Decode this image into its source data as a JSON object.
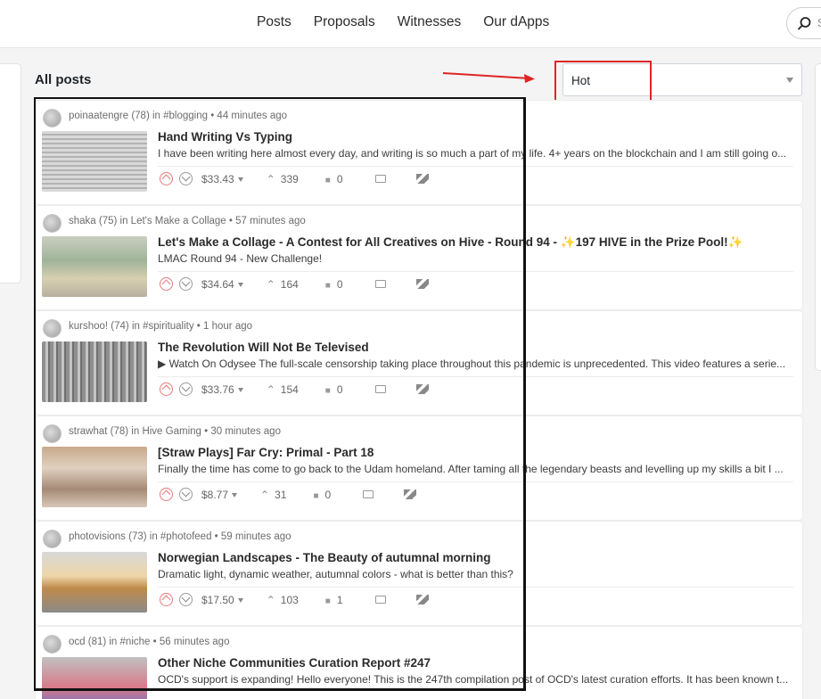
{
  "nav": {
    "items": [
      "Posts",
      "Proposals",
      "Witnesses",
      "Our dApps"
    ],
    "search_peek": "S"
  },
  "section_title": "All posts",
  "sort": {
    "selected": "Hot"
  },
  "colors": {
    "highlight": "#e02525",
    "frame": "#111111"
  },
  "posts": [
    {
      "meta": "poinaatengre (78) in #blogging • 44 minutes ago",
      "title": "Hand Writing Vs Typing",
      "excerpt": "I have been writing here almost every day, and writing is so much a part of my life. 4+ years on the blockchain and I am still going o...",
      "payout": "$33.43",
      "votes": "339",
      "comments": "0"
    },
    {
      "meta": "shaka (75) in Let's Make a Collage • 57 minutes ago",
      "title": "Let's Make a Collage - A Contest for All Creatives on Hive - Round 94 - ✨197 HIVE in the Prize Pool!✨",
      "excerpt": "LMAC Round 94 - New Challenge!",
      "payout": "$34.64",
      "votes": "164",
      "comments": "0"
    },
    {
      "meta": "kurshoo! (74) in #spirituality • 1 hour ago",
      "title": "The Revolution Will Not Be Televised",
      "excerpt": "▶ Watch On Odysee The full-scale censorship taking place throughout this pandemic is unprecedented. This video features a serie...",
      "payout": "$33.76",
      "votes": "154",
      "comments": "0"
    },
    {
      "meta": "strawhat (78) in Hive Gaming • 30 minutes ago",
      "title": "[Straw Plays] Far Cry: Primal - Part 18",
      "excerpt": "Finally the time has come to go back to the Udam homeland. After taming all the legendary beasts and levelling up my skills a bit I ...",
      "payout": "$8.77",
      "votes": "31",
      "comments": "0"
    },
    {
      "meta": "photovisions (73) in #photofeed • 59 minutes ago",
      "title": "Norwegian Landscapes - The Beauty of autumnal morning",
      "excerpt": "Dramatic light, dynamic weather, autumnal colors - what is better than this?",
      "payout": "$17.50",
      "votes": "103",
      "comments": "1"
    },
    {
      "meta": "ocd (81) in #niche • 56 minutes ago",
      "title": "Other Niche Communities Curation Report #247",
      "excerpt": "OCD's support is expanding! Hello everyone! This is the 247th compilation post of OCD's latest curation efforts. It has been known t...",
      "payout": "",
      "votes": "",
      "comments": ""
    }
  ]
}
